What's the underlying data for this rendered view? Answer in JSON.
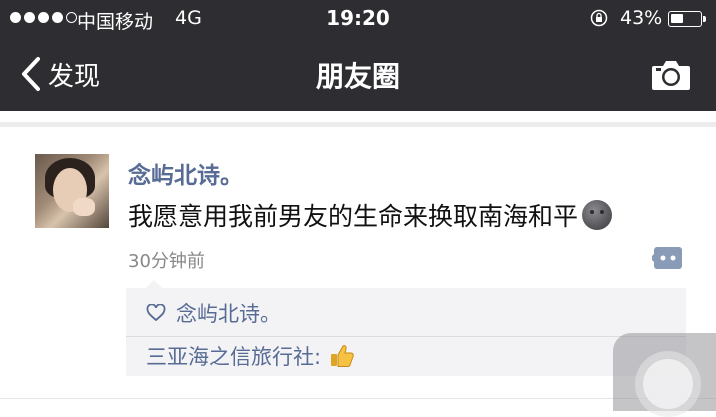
{
  "status_bar": {
    "carrier": "中国移动",
    "network": "4G",
    "time": "19:20",
    "battery_percent": "43%",
    "signal_bars_filled": 4,
    "signal_bars_total": 5,
    "battery_level": 0.43
  },
  "nav": {
    "back_label": "发现",
    "title": "朋友圈",
    "back_icon": "chevron-left-icon",
    "camera_icon": "camera-icon"
  },
  "post": {
    "username": "念屿北诗。",
    "text": "我愿意用我前男友的生命来换取南海和平",
    "emoji": "moon-face-icon",
    "timestamp": "30分钟前"
  },
  "interactions": {
    "likes": [
      "念屿北诗。"
    ],
    "comments": [
      {
        "author": "三亚海之信旅行社:",
        "emoji": "thumbs-up-icon"
      }
    ]
  },
  "colors": {
    "header_bg": "#2e2e32",
    "name_blue": "#576b95",
    "box_bg": "#f3f3f5"
  }
}
